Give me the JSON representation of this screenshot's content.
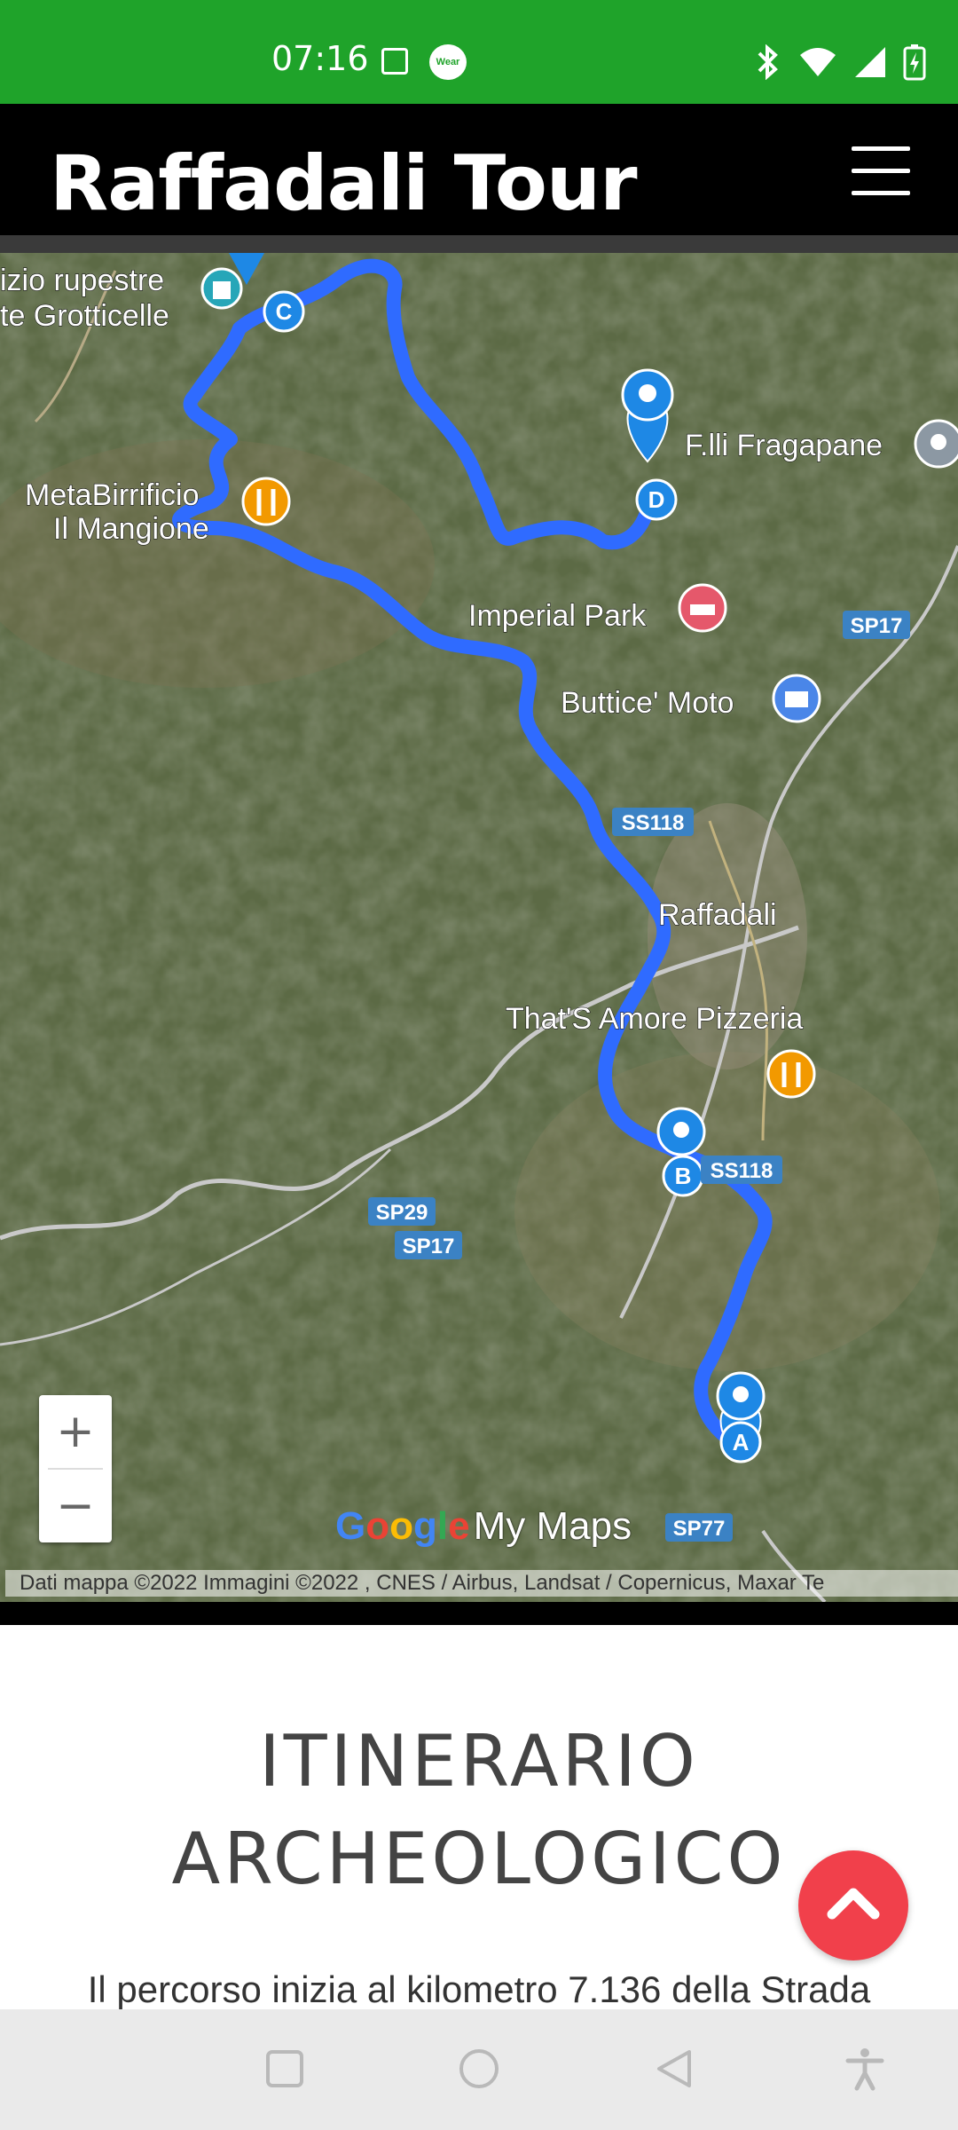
{
  "status_bar": {
    "time": "07:16",
    "icons": [
      "image-icon",
      "wear-icon",
      "bluetooth-icon",
      "wifi-icon",
      "cellular-signal-icon",
      "battery-charging-icon"
    ],
    "wear_label": "Wear"
  },
  "header": {
    "title": "Raffadali Tour",
    "menu_icon": "hamburger-menu-icon"
  },
  "map": {
    "place_labels": {
      "grotticelle_line1": "izio rupestre",
      "grotticelle_line2": "te Grotticelle",
      "birrificio_line1": "MetaBirrificio",
      "birrificio_line2": "Il Mangione",
      "fragapane": "F.lli Fragapane",
      "imperial_park": "Imperial Park",
      "buttice_moto": "Buttice' Moto",
      "raffadali": "Raffadali",
      "pizzeria": "That'S Amore Pizzeria"
    },
    "road_labels": {
      "sp17_east": "SP17",
      "ss118_north": "SS118",
      "ss118_south": "SS118",
      "sp29": "SP29",
      "sp17_west": "SP17",
      "sp77": "SP77"
    },
    "waypoints": [
      "A",
      "B",
      "C",
      "D"
    ],
    "colors": {
      "route": "#2f6bff",
      "marker": "#1e88e5",
      "food_pin": "#f29900",
      "hotel_pin": "#e5586b",
      "shop_pin": "#4a86e8"
    },
    "zoom_in_label": "+",
    "zoom_out_label": "−",
    "brand_google": [
      "G",
      "o",
      "o",
      "g",
      "l",
      "e"
    ],
    "brand_mymaps": "My Maps",
    "attribution": "Dati mappa ©2022 Immagini ©2022 , CNES / Airbus, Landsat / Copernicus, Maxar Te"
  },
  "content": {
    "heading_line1": "ITINERARIO",
    "heading_line2": "ARCHEOLOGICO",
    "paragraph_start": "Il percorso inizia al kilometro 7.136 della Strada",
    "fab_icon": "chevron-up-icon"
  },
  "nav_bar": {
    "icons": [
      "recents-square-icon",
      "home-circle-icon",
      "back-triangle-icon",
      "accessibility-icon"
    ]
  }
}
